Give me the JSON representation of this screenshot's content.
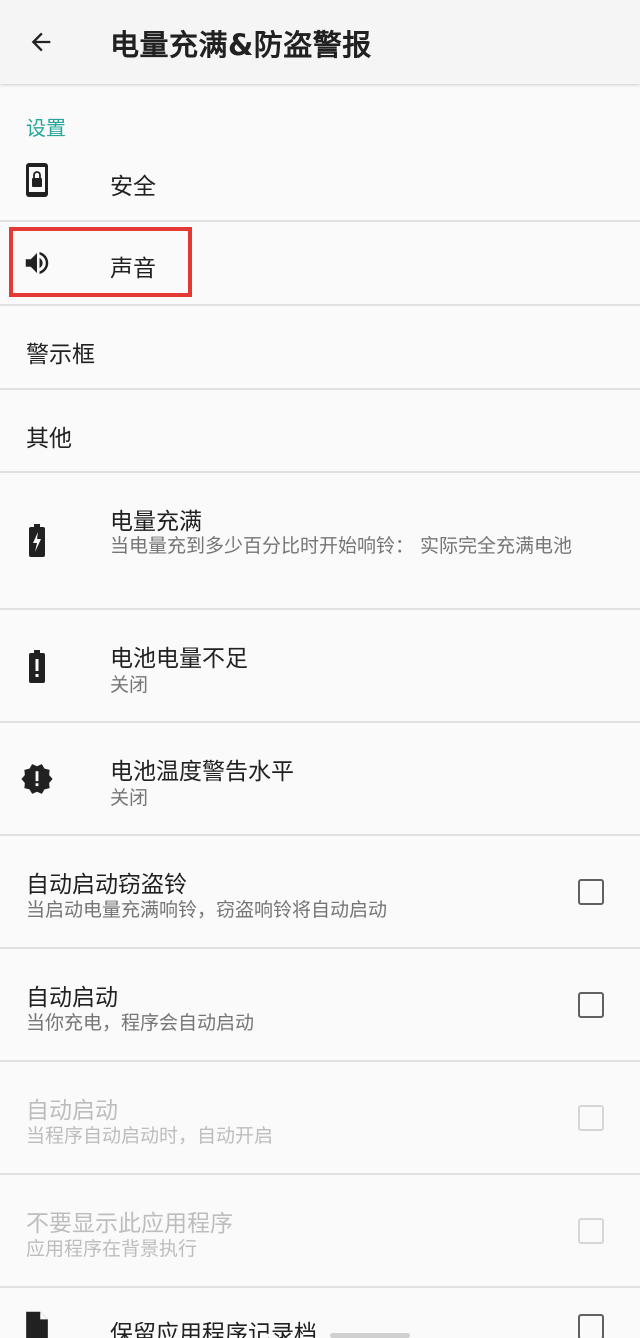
{
  "appbar": {
    "title": "电量充满&防盗警报",
    "back_icon": "arrow-back-icon"
  },
  "section": {
    "header": "设置"
  },
  "items": {
    "security": {
      "title": "安全",
      "icon": "phone-lock-icon"
    },
    "sound": {
      "title": "声音",
      "icon": "volume-icon"
    },
    "alert_box": {
      "title": "警示框"
    },
    "other": {
      "title": "其他"
    },
    "full_charge": {
      "title": "电量充满",
      "summary": "当电量充到多少百分比时开始响铃： 实际完全充满电池",
      "icon": "battery-charging-icon"
    },
    "low_battery": {
      "title": "电池电量不足",
      "summary": "关闭",
      "icon": "battery-alert-icon"
    },
    "battery_temp": {
      "title": "电池温度警告水平",
      "summary": "关闭",
      "icon": "badge-alert-icon"
    },
    "auto_anti_theft": {
      "title": "自动启动窃盗铃",
      "summary": "当启动电量充满响铃，窃盗响铃将自动启动",
      "checked": false
    },
    "auto_start_charge": {
      "title": "自动启动",
      "summary": "当你充电，程序会自动启动",
      "checked": false
    },
    "auto_start_open": {
      "title": "自动启动",
      "summary": "当程序自动启动时，自动开启",
      "checked": false,
      "enabled": false
    },
    "hide_app": {
      "title": "不要显示此应用程序",
      "summary": "应用程序在背景执行",
      "checked": false,
      "enabled": false
    },
    "keep_log": {
      "title": "保留应用程序记录档",
      "icon": "file-icon",
      "checked": false
    }
  },
  "colors": {
    "accent": "#26a69a",
    "highlight": "#e53935"
  }
}
